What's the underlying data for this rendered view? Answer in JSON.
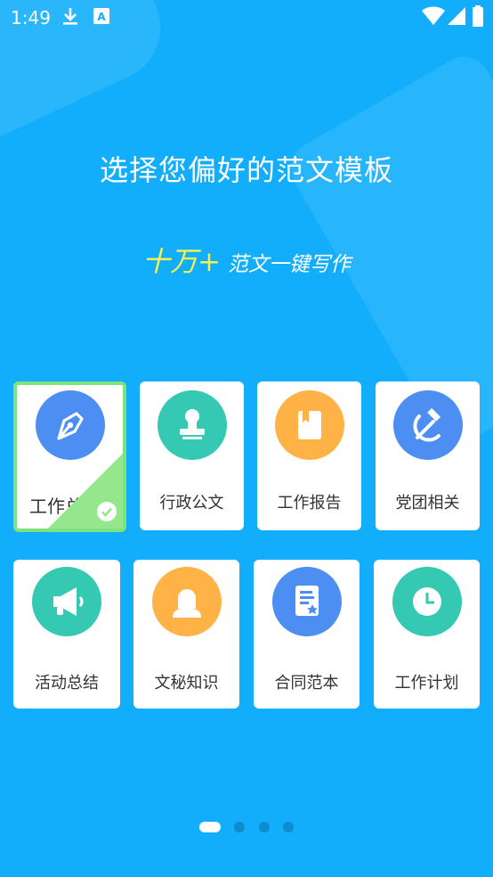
{
  "status_bar": {
    "time": "1:49",
    "left_icons": [
      "download-icon",
      "keyboard-a-icon"
    ],
    "right_icons": [
      "wifi-icon",
      "cell-signal-icon",
      "battery-icon"
    ]
  },
  "title": "选择您偏好的范文模板",
  "slogan": {
    "highlight": "十万+",
    "rest": "范文一键写作"
  },
  "categories": [
    {
      "label": "工作总结",
      "visible_label": "工作总",
      "icon": "pen-nib-icon",
      "selected": true,
      "color": "#4d8ef2"
    },
    {
      "label": "行政公文",
      "icon": "stamp-icon",
      "selected": false,
      "color": "#35c9b3"
    },
    {
      "label": "工作报告",
      "icon": "book-icon",
      "selected": false,
      "color": "#ffb347"
    },
    {
      "label": "党团相关",
      "icon": "hammer-sickle-icon",
      "selected": false,
      "color": "#4d8ef2"
    },
    {
      "label": "活动总结",
      "icon": "megaphone-icon",
      "selected": false,
      "color": "#35c9b3"
    },
    {
      "label": "文秘知识",
      "icon": "secretary-icon",
      "selected": false,
      "color": "#ffb347"
    },
    {
      "label": "合同范本",
      "icon": "contract-icon",
      "selected": false,
      "color": "#4d8ef2"
    },
    {
      "label": "工作计划",
      "icon": "clock-icon",
      "selected": false,
      "color": "#35c9b3"
    }
  ],
  "pager": {
    "current_page": 1,
    "total_pages": 4
  }
}
